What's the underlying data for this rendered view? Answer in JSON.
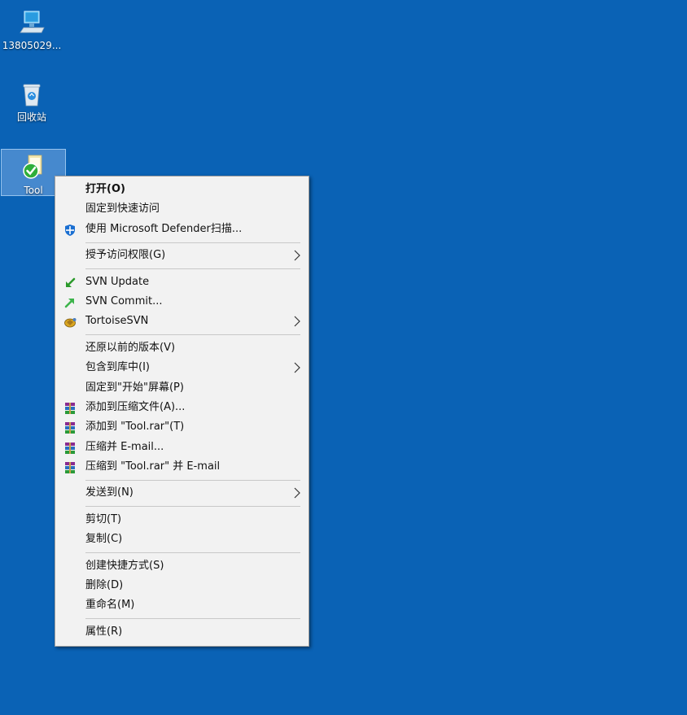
{
  "desktop": {
    "background_color": "#0a62b5",
    "icons": [
      {
        "label": "13805029...",
        "icon": "computer-icon"
      },
      {
        "label": "回收站",
        "icon": "recycle-bin-icon"
      },
      {
        "label": "Tool",
        "icon": "folder-svn-icon",
        "selected": true
      }
    ]
  },
  "context_menu": {
    "groups": [
      [
        {
          "label": "打开(O)",
          "bold": true
        },
        {
          "label": "固定到快速访问"
        },
        {
          "label": "使用 Microsoft Defender扫描...",
          "icon": "defender-shield-icon"
        }
      ],
      [
        {
          "label": "授予访问权限(G)",
          "submenu": true
        }
      ],
      [
        {
          "label": "SVN Update",
          "icon": "svn-update-icon"
        },
        {
          "label": "SVN Commit...",
          "icon": "svn-commit-icon"
        },
        {
          "label": "TortoiseSVN",
          "icon": "tortoisesvn-icon",
          "submenu": true
        }
      ],
      [
        {
          "label": "还原以前的版本(V)"
        },
        {
          "label": "包含到库中(I)",
          "submenu": true
        },
        {
          "label": "固定到\"开始\"屏幕(P)"
        },
        {
          "label": "添加到压缩文件(A)...",
          "icon": "winrar-icon"
        },
        {
          "label": "添加到 \"Tool.rar\"(T)",
          "icon": "winrar-icon"
        },
        {
          "label": "压缩并 E-mail...",
          "icon": "winrar-icon"
        },
        {
          "label": "压缩到 \"Tool.rar\" 并 E-mail",
          "icon": "winrar-icon"
        }
      ],
      [
        {
          "label": "发送到(N)",
          "submenu": true
        }
      ],
      [
        {
          "label": "剪切(T)"
        },
        {
          "label": "复制(C)"
        }
      ],
      [
        {
          "label": "创建快捷方式(S)"
        },
        {
          "label": "删除(D)"
        },
        {
          "label": "重命名(M)"
        }
      ],
      [
        {
          "label": "属性(R)"
        }
      ]
    ]
  }
}
